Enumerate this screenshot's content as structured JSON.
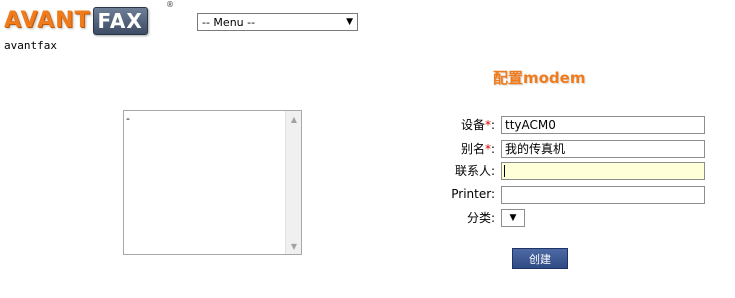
{
  "logo": {
    "part1": "AVANT",
    "part2": "FAX",
    "registered": "®"
  },
  "user": {
    "name": "avantfax"
  },
  "menu": {
    "selected": "-- Menu --",
    "arrow_icon": "triangle-down"
  },
  "page": {
    "title": "配置modem"
  },
  "notes": {
    "value": "-"
  },
  "form": {
    "device": {
      "label": "设备",
      "required_mark": "*",
      "colon": ":",
      "value": "ttyACM0"
    },
    "alias": {
      "label": "别名",
      "required_mark": "*",
      "colon": ":",
      "value": "我的传真机"
    },
    "contact": {
      "label": "联系人:",
      "value": ""
    },
    "printer": {
      "label": "Printer:",
      "value": ""
    },
    "category": {
      "label": "分类:",
      "value": ""
    },
    "submit_label": "创建"
  },
  "colors": {
    "accent_orange": "#f07b1c",
    "button_blue": "#2f4b85",
    "focus_yellow": "#ffffd8",
    "required_red": "#dd0000"
  }
}
